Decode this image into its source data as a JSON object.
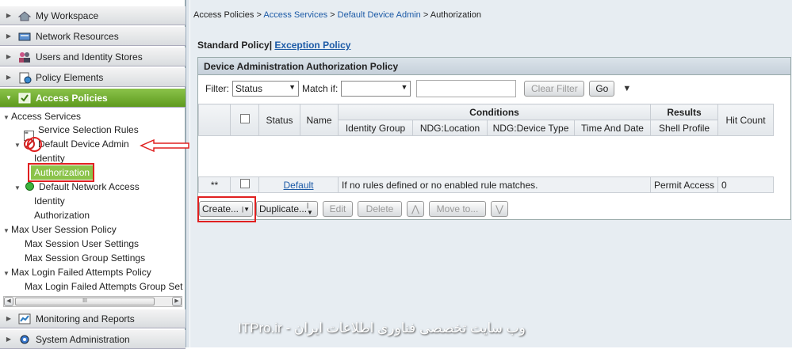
{
  "nav": {
    "drawers_top": [
      {
        "label": "My Workspace",
        "icon": "workspace-icon"
      },
      {
        "label": "Network Resources",
        "icon": "network-icon"
      },
      {
        "label": "Users and Identity Stores",
        "icon": "users-icon"
      },
      {
        "label": "Policy Elements",
        "icon": "policy-elements-icon"
      },
      {
        "label": "Access Policies",
        "icon": "access-policies-icon"
      }
    ],
    "tree": {
      "access_services": "Access Services",
      "service_selection_rules": "Service Selection Rules",
      "default_device_admin": "Default Device Admin",
      "identity_1": "Identity",
      "authorization_1": "Authorization",
      "default_network_access": "Default Network Access",
      "identity_2": "Identity",
      "authorization_2": "Authorization",
      "max_user_session_policy": "Max User Session Policy",
      "max_session_user_settings": "Max Session User Settings",
      "max_session_group_settings": "Max Session Group Settings",
      "max_login_failed_attempts_policy": "Max Login Failed Attempts Policy",
      "max_login_failed_attempts_group": "Max Login Failed Attempts Group Set"
    },
    "scroll_grip": "III",
    "drawers_bottom": [
      {
        "label": "Monitoring and Reports",
        "icon": "monitoring-icon"
      },
      {
        "label": "System Administration",
        "icon": "system-admin-icon"
      }
    ],
    "accent_color": "#6faa2c"
  },
  "breadcrumb": {
    "root": "Access Policies",
    "sep": ">",
    "access_services": "Access Services",
    "default_device_admin": "Default Device Admin",
    "current": "Authorization"
  },
  "policy_tabs": {
    "standard": "Standard Policy|",
    "exception": "Exception Policy"
  },
  "panel": {
    "title": "Device Administration Authorization Policy",
    "filter_label": "Filter:",
    "filter_value": "Status",
    "match_if_label": "Match if:",
    "match_if_value": "",
    "filter_text": "",
    "clear_filter": "Clear Filter",
    "go": "Go"
  },
  "table": {
    "headers": {
      "status": "Status",
      "name": "Name",
      "conditions": "Conditions",
      "identity_group": "Identity Group",
      "ndg_location": "NDG:Location",
      "ndg_device_type": "NDG:Device Type",
      "time_and_date": "Time And Date",
      "results": "Results",
      "shell_profile": "Shell Profile",
      "hit_count": "Hit Count"
    },
    "default_row": {
      "marker": "**",
      "name": "Default",
      "description": "If no rules defined or no enabled rule matches.",
      "result": "Permit Access",
      "hits": "0"
    }
  },
  "actions": {
    "create": "Create...",
    "duplicate": "Duplicate...",
    "edit": "Edit",
    "delete": "Delete",
    "move_to": "Move to..."
  },
  "watermark": "ITPro.ir - وب سایت تخصصی فناوری اطلاعات ایران"
}
